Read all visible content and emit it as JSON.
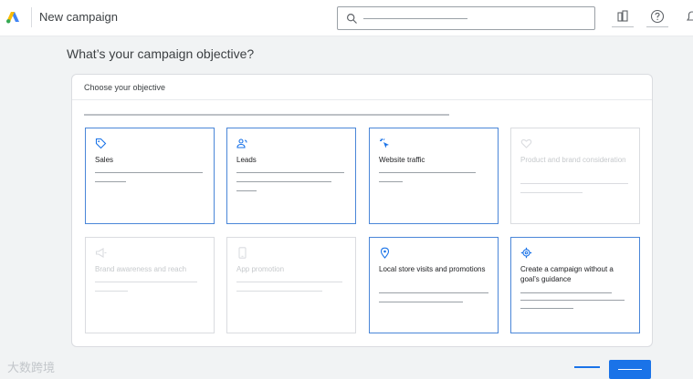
{
  "header": {
    "app_title": "New campaign",
    "icons": [
      "google-ads-logo",
      "search-icon",
      "reports-icon",
      "help-icon",
      "notifications-icon"
    ]
  },
  "page": {
    "title": "What’s your campaign objective?"
  },
  "panel": {
    "header": "Choose your objective"
  },
  "objectives": [
    {
      "label": "Sales",
      "icon": "tag-icon",
      "selected": true,
      "enabled": true
    },
    {
      "label": "Leads",
      "icon": "people-icon",
      "selected": true,
      "enabled": true
    },
    {
      "label": "Website traffic",
      "icon": "cursor-click-icon",
      "selected": true,
      "enabled": true
    },
    {
      "label": "Product and brand consideration",
      "icon": "heart-icon",
      "selected": false,
      "enabled": false
    },
    {
      "label": "Brand awareness and reach",
      "icon": "megaphone-icon",
      "selected": false,
      "enabled": false
    },
    {
      "label": "App promotion",
      "icon": "phone-icon",
      "selected": false,
      "enabled": false
    },
    {
      "label": "Local store visits and promotions",
      "icon": "location-pin-icon",
      "selected": true,
      "enabled": true
    },
    {
      "label": "Create a campaign without a goal’s guidance",
      "icon": "settings-icon",
      "selected": true,
      "enabled": true
    }
  ],
  "watermark": "大数跨境",
  "colors": {
    "accent": "#1a73e8",
    "selected_border": "#4a86d8",
    "disabled_text": "#c6c9cc"
  }
}
